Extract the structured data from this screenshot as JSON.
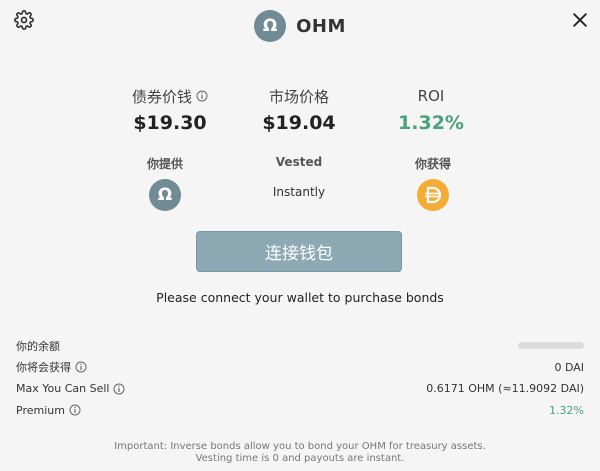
{
  "header": {
    "token_symbol": "Ω",
    "token_name": "OHM",
    "icons": [
      "gear-icon",
      "close-icon"
    ]
  },
  "stats": {
    "bond_price": {
      "label": "债券价钱",
      "value": "$19.30"
    },
    "market_price": {
      "label": "市场价格",
      "value": "$19.04"
    },
    "roi": {
      "label": "ROI",
      "value": "1.32%"
    }
  },
  "flow": {
    "you_give": {
      "label": "你提供",
      "symbol": "Ω"
    },
    "vested": {
      "label": "Vested",
      "value": "Instantly"
    },
    "you_get": {
      "label": "你获得",
      "icon": "dai-icon"
    }
  },
  "actions": {
    "connect_label": "连接钱包"
  },
  "connect_message": "Please connect your wallet to purchase bonds",
  "details": {
    "balance": {
      "label": "你的余额"
    },
    "will_get": {
      "label": "你将会获得",
      "value": "0 DAI"
    },
    "max_sell": {
      "label": "Max You Can Sell",
      "value": "0.6171 OHM (≈11.9092 DAI)"
    },
    "premium": {
      "label": "Premium",
      "value": "1.32%"
    }
  },
  "footer": {
    "line1": "Important: Inverse bonds allow you to bond your OHM for treasury assets.",
    "line2": "Vesting time is 0 and payouts are instant."
  },
  "colors": {
    "accent": "#49A27A",
    "ohm": "#708B96",
    "dai": "#F5AC37",
    "button": "#8DA9B4"
  }
}
